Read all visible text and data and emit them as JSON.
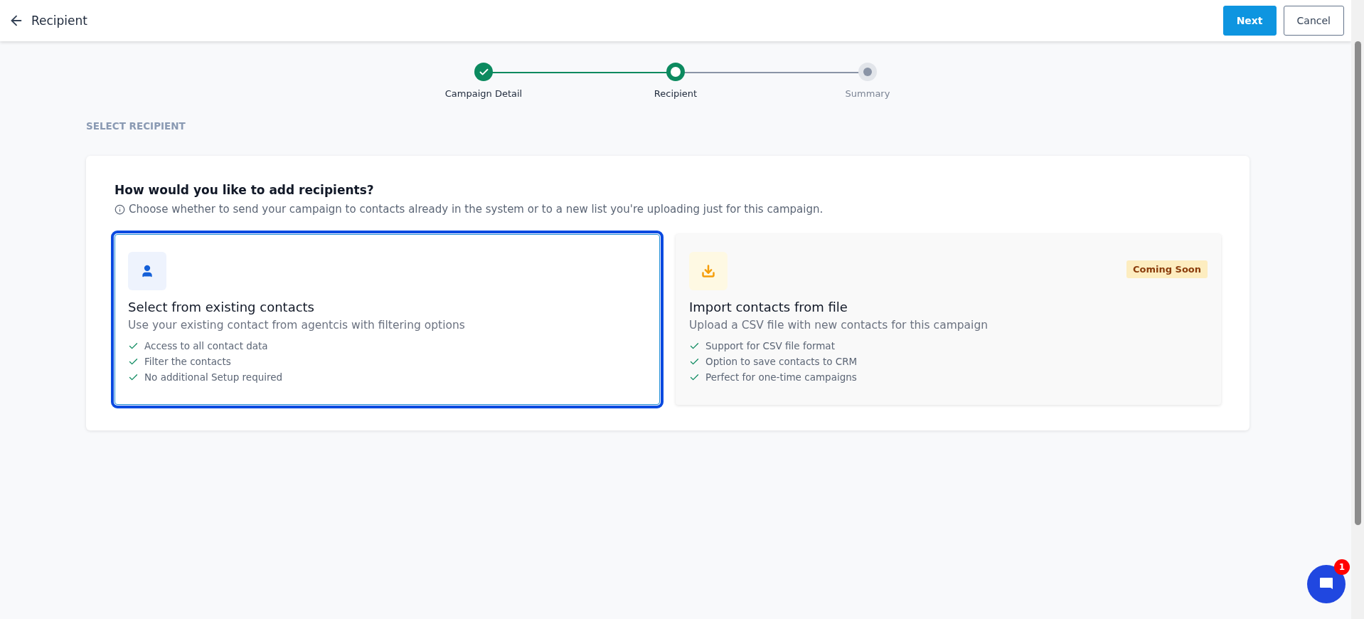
{
  "header": {
    "title": "Recipient",
    "buttons": [
      {
        "label": "Next",
        "kind": "primary"
      },
      {
        "label": "Cancel",
        "kind": "secondary"
      }
    ]
  },
  "steps": [
    {
      "label": "Campaign Detail",
      "completed": true,
      "selected": false
    },
    {
      "label": "Recipient",
      "completed": false,
      "selected": true
    },
    {
      "label": "Summary",
      "completed": false,
      "selected": false
    }
  ],
  "section_title": "SELECT RECIPIENT",
  "card": {
    "question": "How would you like to add recipients?",
    "hint": "Choose whether to send your campaign to contacts already in the system or to a new list you're uploading just for this campaign.",
    "options": [
      {
        "kind": "contacts",
        "title": "Select from existing contacts",
        "description": "Use your existing contact from agentcis with filtering options",
        "selected": true,
        "features": [
          "Access to all contact data",
          "Filter the contacts",
          "No additional Setup required"
        ]
      },
      {
        "kind": "file",
        "title": "Import contacts from file",
        "description": "Upload a CSV file with new contacts for this campaign",
        "selected": false,
        "badge": "Coming Soon",
        "features": [
          "Support for CSV file format",
          "Option to save contacts to CRM",
          "Perfect for one-time campaigns"
        ]
      }
    ]
  },
  "chat": {
    "unread": "1"
  }
}
